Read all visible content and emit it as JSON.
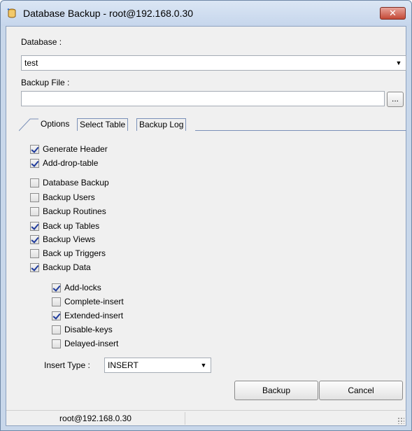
{
  "window": {
    "title": "Database Backup - root@192.168.0.30",
    "close_symbol": "✕"
  },
  "database": {
    "label": "Database :",
    "selected": "test"
  },
  "backup_file": {
    "label": "Backup File :",
    "value": "",
    "browse_label": "..."
  },
  "tabs": [
    {
      "label": "Options",
      "active": true
    },
    {
      "label": "Select Table",
      "active": false
    },
    {
      "label": "Backup Log",
      "active": false
    }
  ],
  "options": {
    "group1": [
      {
        "label": "Generate Header",
        "checked": true
      },
      {
        "label": "Add-drop-table",
        "checked": true
      }
    ],
    "group2": [
      {
        "label": "Database Backup",
        "checked": false
      },
      {
        "label": "Backup Users",
        "checked": false
      },
      {
        "label": "Backup Routines",
        "checked": false
      },
      {
        "label": "Back up Tables",
        "checked": true
      },
      {
        "label": "Backup Views",
        "checked": true
      },
      {
        "label": "Back up Triggers",
        "checked": false
      },
      {
        "label": "Backup Data",
        "checked": true
      }
    ],
    "data_options": [
      {
        "label": "Add-locks",
        "checked": true
      },
      {
        "label": "Complete-insert",
        "checked": false
      },
      {
        "label": "Extended-insert",
        "checked": true
      },
      {
        "label": "Disable-keys",
        "checked": false
      },
      {
        "label": "Delayed-insert",
        "checked": false
      }
    ],
    "insert_type_label": "Insert Type :",
    "insert_type_value": "INSERT"
  },
  "buttons": {
    "backup": "Backup",
    "cancel": "Cancel"
  },
  "status": {
    "connection": "root@192.168.0.30"
  },
  "icons": {
    "app": "database-backup-icon",
    "dropdown": "chevron-down-icon",
    "close": "close-icon"
  }
}
